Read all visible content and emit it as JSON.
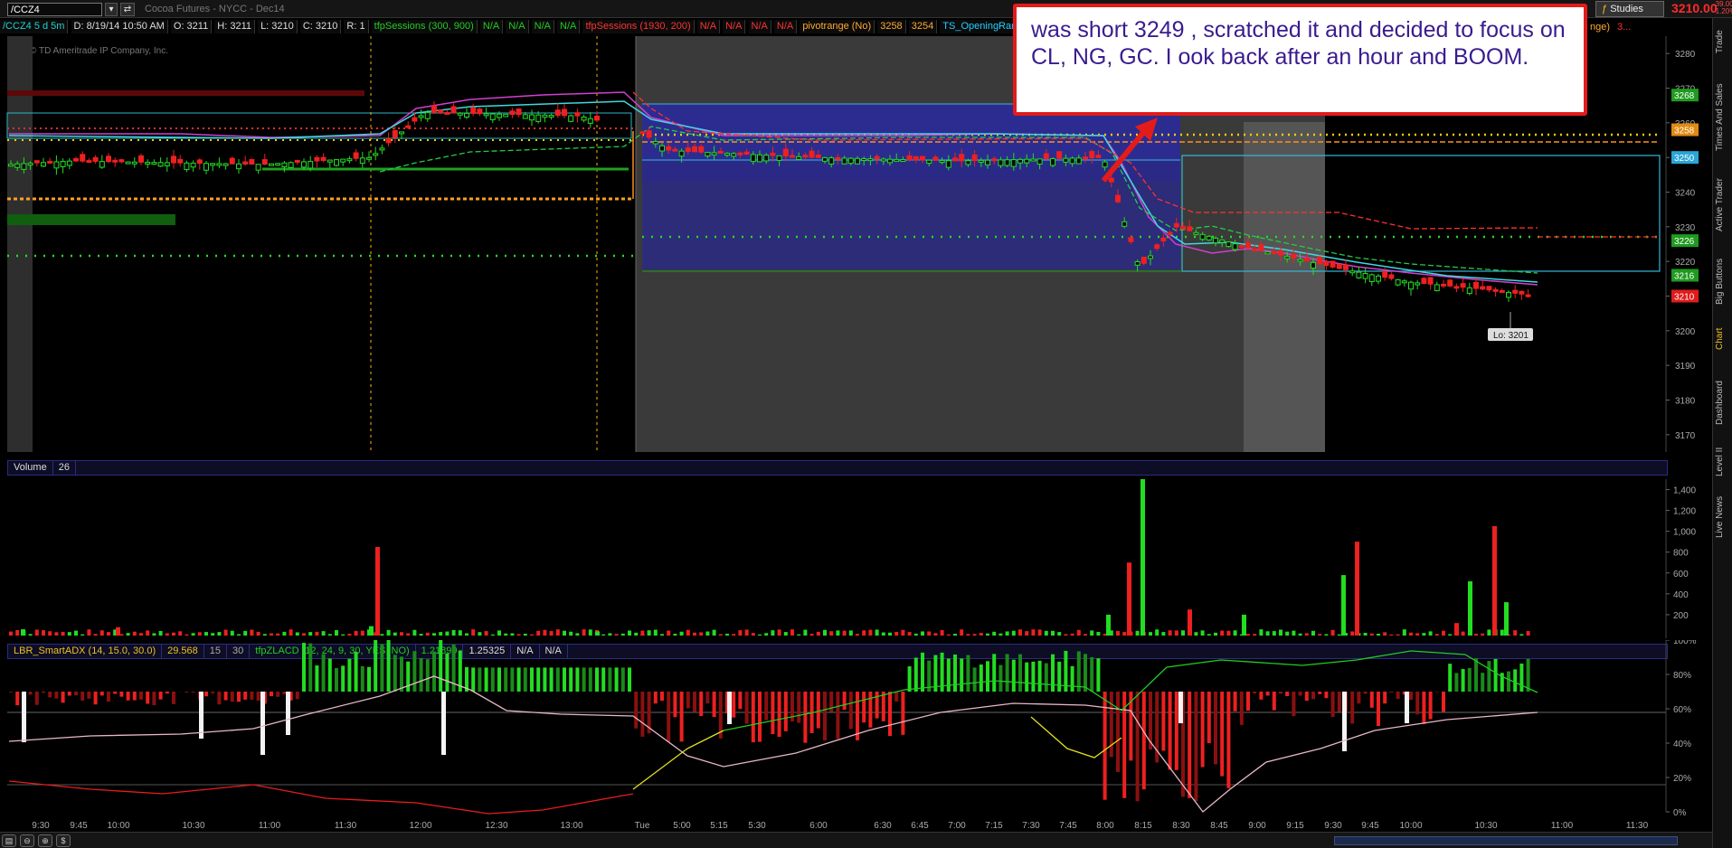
{
  "toolbar": {
    "symbol": "/CCZ4",
    "chart_title": "Cocoa Futures - NYCC - Dec14",
    "studies_label": "Studies",
    "last_price": "3210.00",
    "price_change": "-39.00 -1.20%",
    "btn_dropdown": "▾",
    "btn_link": "⇄"
  },
  "statusline": {
    "symbol_period": "/CCZ4 5 d 5m",
    "date": "D: 8/19/14 10:50 AM",
    "open": "O: 3211",
    "high": "H: 3211",
    "low": "L: 3210",
    "close": "C: 3210",
    "range": "R: 1",
    "session1": "tfpSessions (300, 900)",
    "na1": "N/A",
    "na2": "N/A",
    "na3": "N/A",
    "na4": "N/A",
    "session2": "tfpSessions (1930, 200)",
    "na5": "N/A",
    "na6": "N/A",
    "na7": "N/A",
    "na8": "N/A",
    "pivot": "pivotrange (No)",
    "p1": "3258",
    "p2": "3254",
    "orcloud": "TS_OpeningRangeCloud",
    "right_fragment": "nge)",
    "right_fragment2": "3..."
  },
  "copyright": "2014 © TD Ameritrade IP Company, Inc.",
  "annotation": "was short 3249 , scratched it and decided to focus on CL, NG, GC. I ook back after an hour and BOOM.",
  "price_axis": {
    "ticks": [
      "3280",
      "3270",
      "3260",
      "3250",
      "3240",
      "3230",
      "3220",
      "3210",
      "3200",
      "3190",
      "3180",
      "3170"
    ],
    "markers": [
      {
        "label": "3268",
        "value": 3268,
        "color": "#1f9a1f"
      },
      {
        "label": "3258",
        "value": 3258,
        "color": "#e08a12"
      },
      {
        "label": "3250",
        "value": 3250,
        "color": "#2aa6d6"
      },
      {
        "label": "3226",
        "value": 3226,
        "color": "#1f9a1f"
      },
      {
        "label": "3216",
        "value": 3216,
        "color": "#1f9a1f"
      },
      {
        "label": "3210",
        "value": 3210,
        "color": "#e01b1b"
      }
    ],
    "low_label": "Lo: 3201"
  },
  "volume_panel": {
    "title": "Volume",
    "value": "26",
    "ticks": [
      "1,400",
      "1,200",
      "1,000",
      "800",
      "600",
      "400",
      "200"
    ]
  },
  "osc_panel": {
    "study1": "LBR_SmartADX (14, 15.0, 30.0)",
    "study1_value": "29.568",
    "v15": "15",
    "v30": "30",
    "study2": "tfpZLACD (12, 24, 9, 30, YES, NO)",
    "v_a": "1.21899",
    "v_b": "1.25325",
    "na_a": "N/A",
    "na_b": "N/A",
    "ticks": [
      "100%",
      "80%",
      "60%",
      "40%",
      "20%",
      "0%"
    ]
  },
  "time_axis": [
    "9:30",
    "9:45",
    "10:00",
    "10:30",
    "11:00",
    "11:30",
    "12:00",
    "12:30",
    "13:00",
    "Tue",
    "5:00",
    "5:15",
    "5:30",
    "6:00",
    "6:30",
    "6:45",
    "7:00",
    "7:15",
    "7:30",
    "7:45",
    "8:00",
    "8:15",
    "8:30",
    "8:45",
    "9:00",
    "9:15",
    "9:30",
    "9:45",
    "10:00",
    "10:30",
    "11:00",
    "11:30"
  ],
  "right_tabs": [
    "Trade",
    "Times And Sales",
    "Active Trader",
    "Big Buttons",
    "Chart",
    "Dashboard",
    "Level II",
    "Live News"
  ],
  "colors": {
    "up": "#22cc22",
    "down": "#e81c1c",
    "accent": "#e31b1b"
  },
  "chart_data": [
    {
      "type": "line",
      "title": "",
      "ylim": [
        3165,
        3285
      ],
      "note_values": "approx closes read from candles",
      "x": [
        "9:30",
        "10:00",
        "11:00",
        "11:30",
        "12:00",
        "13:00",
        "Tue",
        "5:00",
        "6:00",
        "7:00",
        "8:00",
        "8:15",
        "8:30",
        "9:00",
        "9:30",
        "10:00",
        "10:30",
        "10:50"
      ],
      "series": [
        {
          "values": [
            3248,
            3249,
            3248,
            3250,
            3263,
            3262,
            3258,
            3252,
            3250,
            3249,
            3250,
            3218,
            3230,
            3224,
            3218,
            3214,
            3212,
            3210
          ]
        }
      ]
    },
    {
      "type": "bar",
      "title": "Volume",
      "ylim": [
        0,
        1500
      ],
      "categories": [
        "9:30",
        "10:30",
        "11:30",
        "12:00",
        "13:00",
        "5:00",
        "8:00",
        "8:10",
        "8:15",
        "8:30",
        "9:00",
        "9:35",
        "9:40",
        "10:00",
        "10:25",
        "10:35",
        "10:40"
      ],
      "values": [
        60,
        80,
        90,
        850,
        40,
        10,
        200,
        700,
        1500,
        250,
        200,
        900,
        580,
        120,
        520,
        1050,
        320
      ]
    },
    {
      "type": "line",
      "title": "LBR_SmartADX",
      "ylim": [
        0,
        100
      ],
      "series": [
        {
          "values": [
            62,
            63,
            70,
            88,
            92,
            88,
            68,
            38,
            30,
            50,
            68,
            72,
            62,
            48,
            35,
            78,
            98,
            95,
            82
          ]
        },
        {
          "values": [
            60,
            58,
            61,
            88,
            82,
            60,
            40,
            35,
            55,
            65,
            78,
            80,
            60,
            42,
            20,
            45,
            78,
            88,
            80
          ]
        }
      ]
    }
  ]
}
